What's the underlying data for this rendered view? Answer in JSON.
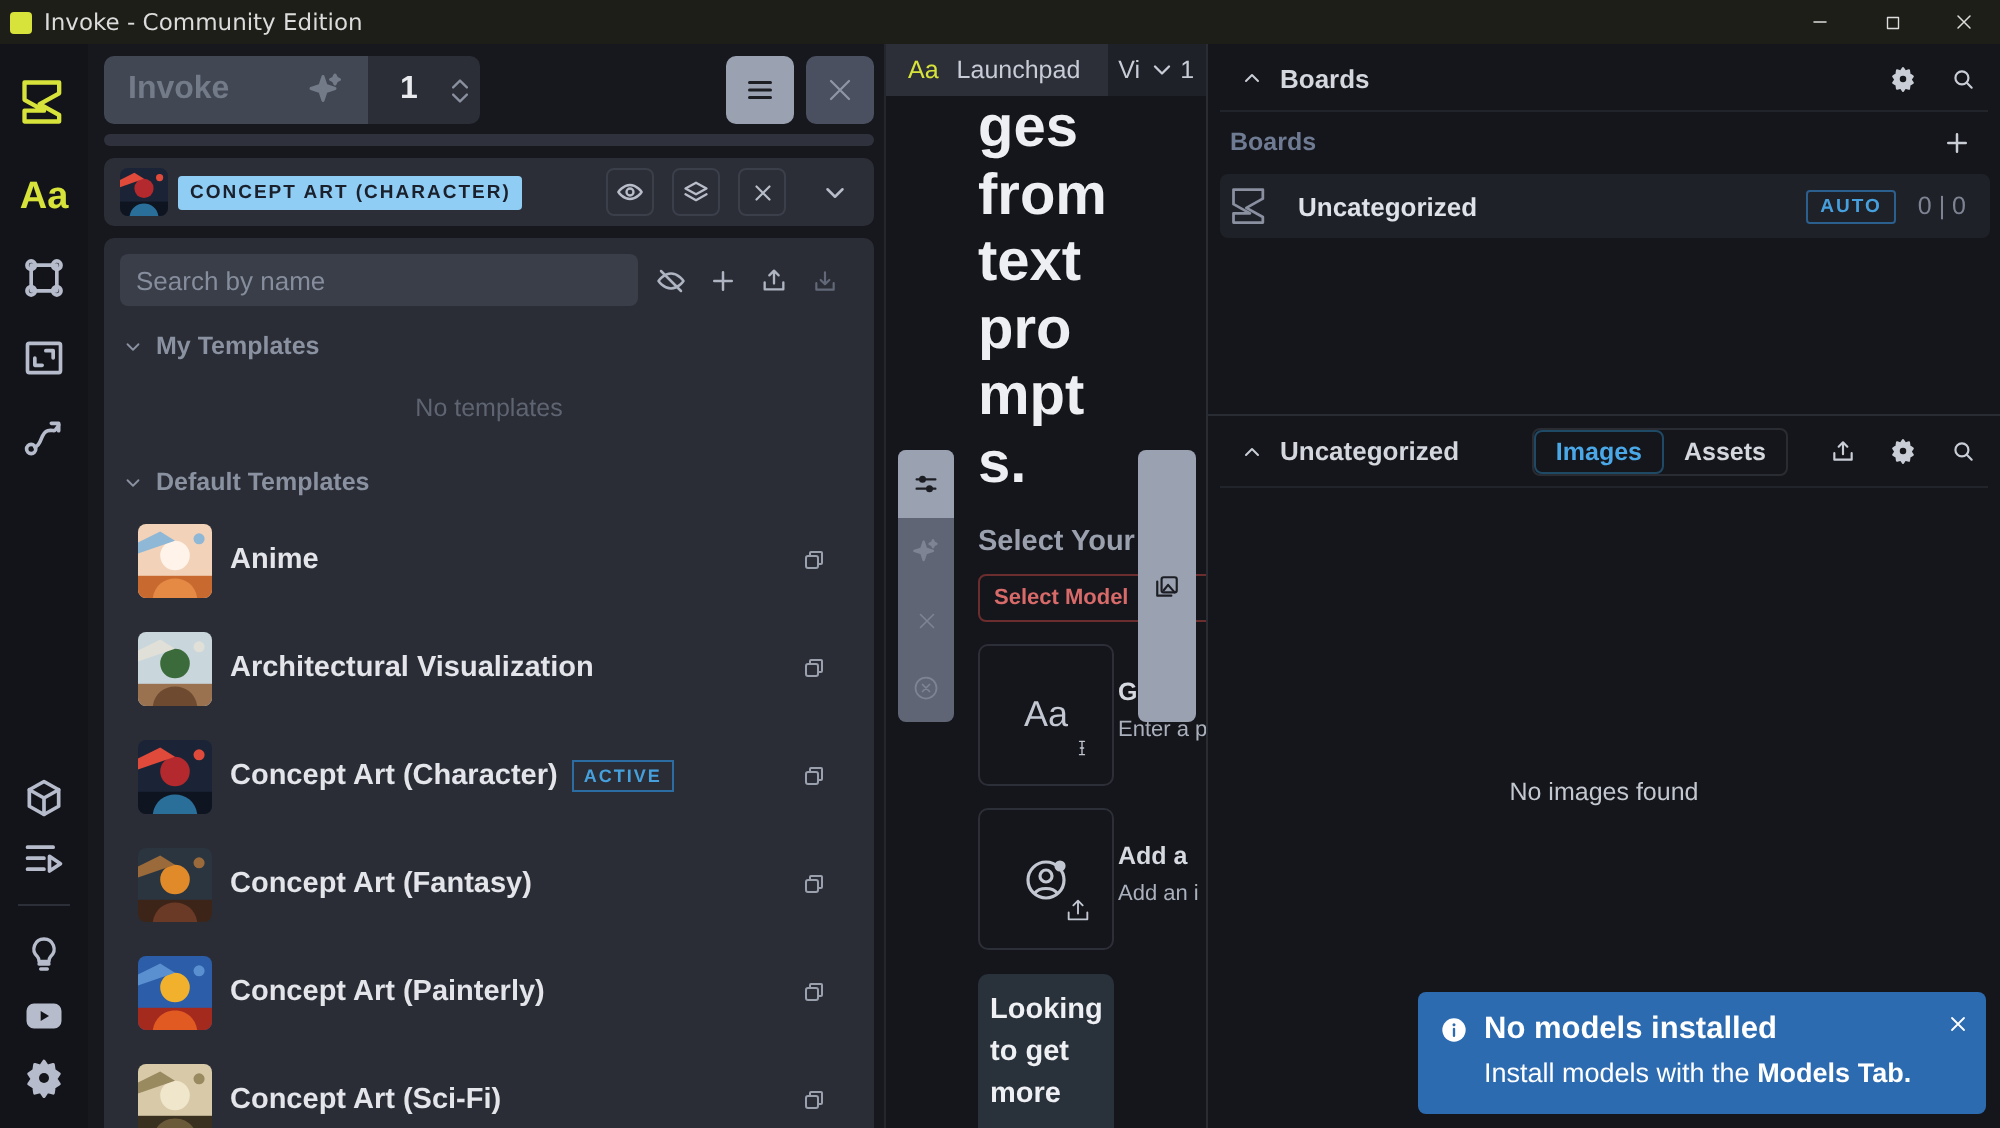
{
  "window": {
    "title": "Invoke - Community Edition"
  },
  "rail": {
    "tabs": [
      {
        "glyph": "Aa",
        "selected": true
      },
      {
        "selected": false
      },
      {
        "selected": false
      },
      {
        "selected": false
      },
      {
        "selected": false
      },
      {
        "selected": false
      }
    ]
  },
  "invoke_button": {
    "label": "Invoke",
    "disabled": true
  },
  "iterations": {
    "value": "1"
  },
  "progress": {
    "level": 0
  },
  "active_preset": {
    "badge": "CONCEPT ART (CHARACTER)"
  },
  "templates": {
    "search": {
      "placeholder": "Search by name"
    },
    "my_templates": {
      "title": "My Templates",
      "empty_text": "No templates"
    },
    "default_templates": {
      "title": "Default Templates",
      "items": [
        {
          "name": "Anime"
        },
        {
          "name": "Architectural Visualization"
        },
        {
          "name": "Concept Art (Character)",
          "badge": "ACTIVE"
        },
        {
          "name": "Concept Art (Fantasy)"
        },
        {
          "name": "Concept Art (Painterly)"
        },
        {
          "name": "Concept Art (Sci-Fi)"
        }
      ]
    }
  },
  "launchpad": {
    "tabs": [
      {
        "glyph": "Aa",
        "label": "Launchpad",
        "selected": true
      },
      {
        "label": "Vi",
        "selected": false
      }
    ],
    "tab_count": "1",
    "headline": "ges from text prompts.",
    "model_heading": "Select Your",
    "model_select": {
      "placeholder": "Select Model"
    },
    "cards": [
      {
        "kind": "prompt",
        "glyph": "Aa",
        "title": "G",
        "text": "Enter a p"
      },
      {
        "kind": "upload",
        "title": "Add a",
        "text": "Add an i"
      }
    ],
    "promo": "Looking to get more"
  },
  "boards": {
    "title": "Boards",
    "list_label": "Boards",
    "items": [
      {
        "name": "Uncategorized",
        "badge": "AUTO",
        "count": "0 | 0",
        "selected": true
      }
    ]
  },
  "gallery": {
    "title": "Uncategorized",
    "tabs": [
      {
        "label": "Images",
        "selected": true
      },
      {
        "label": "Assets",
        "selected": false
      }
    ],
    "empty_text": "No images found"
  },
  "toast": {
    "title": "No models installed",
    "message": "Install models with the **Models Tab.**"
  }
}
